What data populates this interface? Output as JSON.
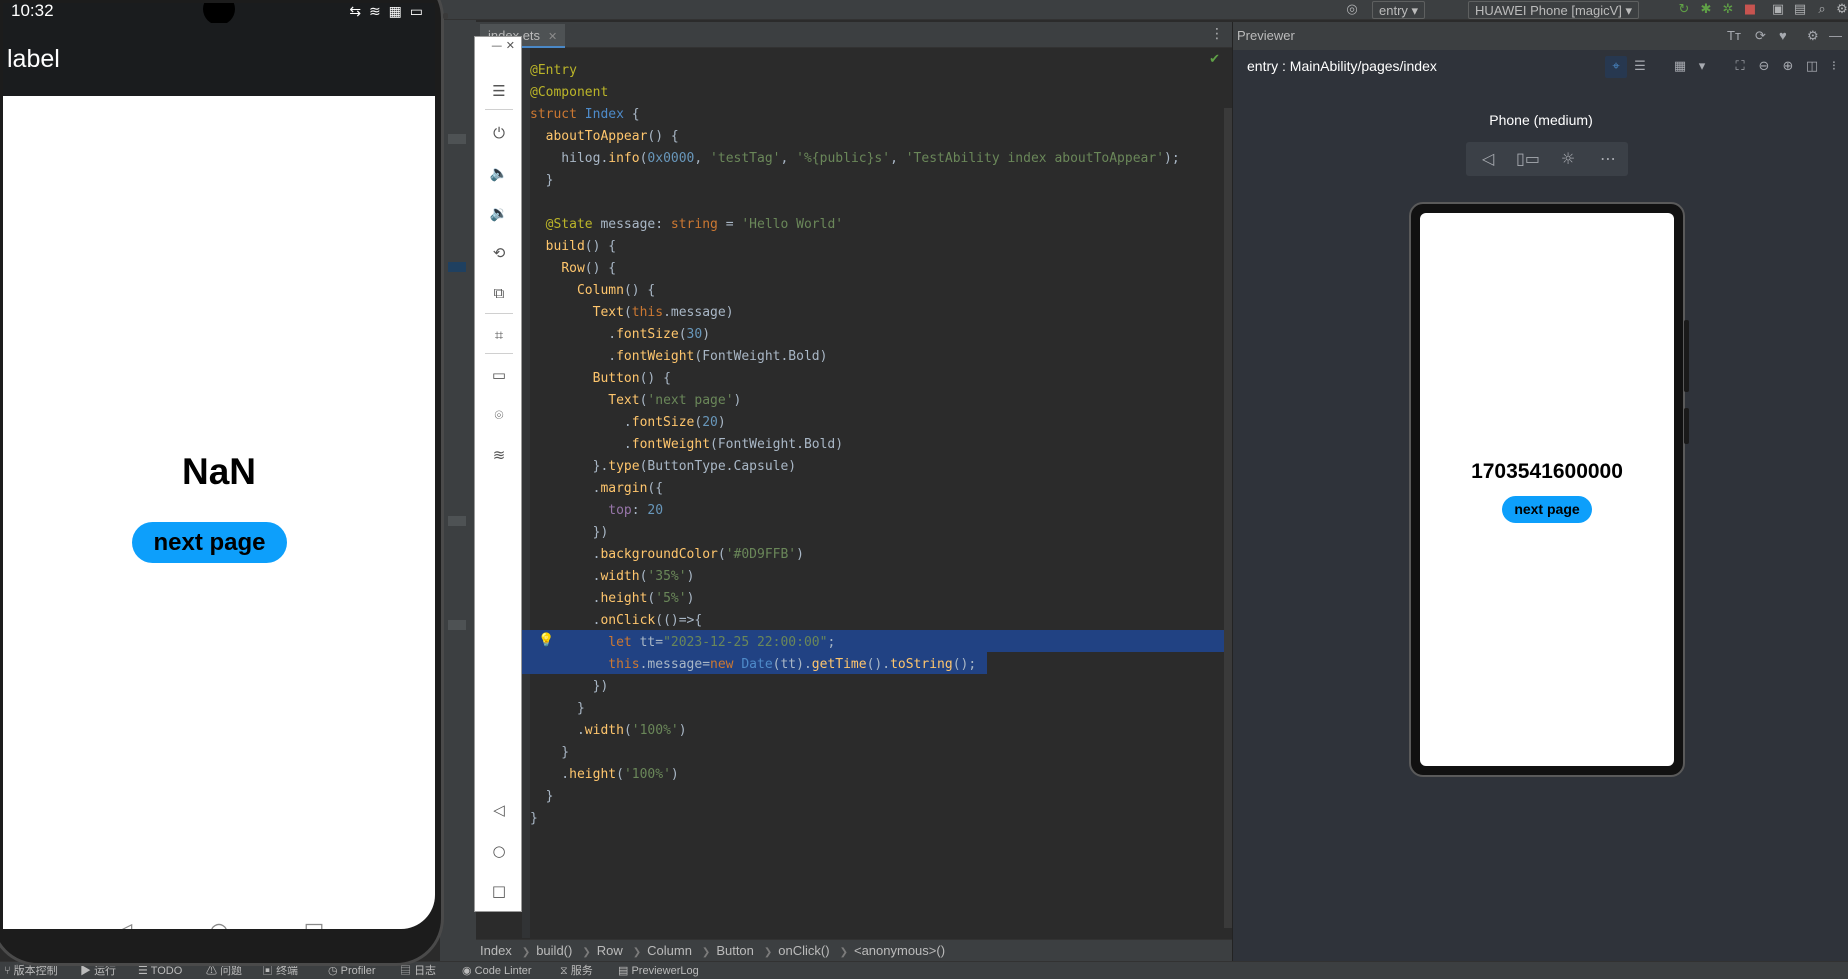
{
  "toolbar": {
    "run_config": "entry",
    "device": "HUAWEI Phone [magicV]"
  },
  "editor": {
    "tab_name": "index.ets",
    "lines": [
      [
        [
          "an",
          "@Entry"
        ]
      ],
      [
        [
          "an",
          "@Component"
        ]
      ],
      [
        [
          "kw",
          "struct "
        ],
        [
          "ty",
          "Index"
        ],
        [
          "df",
          " {"
        ]
      ],
      [
        [
          "df",
          "  "
        ],
        [
          "fn",
          "aboutToAppear"
        ],
        [
          "df",
          "() {"
        ]
      ],
      [
        [
          "df",
          "    hilog."
        ],
        [
          "fn",
          "info"
        ],
        [
          "df",
          "("
        ],
        [
          "nm",
          "0x0000"
        ],
        [
          "df",
          ", "
        ],
        [
          "st",
          "'testTag'"
        ],
        [
          "df",
          ", "
        ],
        [
          "st",
          "'%{public}s'"
        ],
        [
          "df",
          ", "
        ],
        [
          "st",
          "'TestAbility index aboutToAppear'"
        ],
        [
          "df",
          ");"
        ]
      ],
      [
        [
          "df",
          "  }"
        ]
      ],
      [
        [
          "df",
          ""
        ]
      ],
      [
        [
          "an",
          "  @State "
        ],
        [
          "df",
          "message: "
        ],
        [
          "kw",
          "string"
        ],
        [
          "df",
          " = "
        ],
        [
          "st",
          "'Hello World'"
        ]
      ],
      [
        [
          "df",
          "  "
        ],
        [
          "fn",
          "build"
        ],
        [
          "df",
          "() {"
        ]
      ],
      [
        [
          "df",
          "    "
        ],
        [
          "fn",
          "Row"
        ],
        [
          "df",
          "() {"
        ]
      ],
      [
        [
          "df",
          "      "
        ],
        [
          "fn",
          "Column"
        ],
        [
          "df",
          "() {"
        ]
      ],
      [
        [
          "df",
          "        "
        ],
        [
          "fn",
          "Text"
        ],
        [
          "df",
          "("
        ],
        [
          "kw",
          "this"
        ],
        [
          "df",
          ".message)"
        ]
      ],
      [
        [
          "df",
          "          ."
        ],
        [
          "fn",
          "fontSize"
        ],
        [
          "df",
          "("
        ],
        [
          "nm",
          "30"
        ],
        [
          "df",
          ")"
        ]
      ],
      [
        [
          "df",
          "          ."
        ],
        [
          "fn",
          "fontWeight"
        ],
        [
          "df",
          "(FontWeight.Bold)"
        ]
      ],
      [
        [
          "df",
          "        "
        ],
        [
          "fn",
          "Button"
        ],
        [
          "df",
          "() {"
        ]
      ],
      [
        [
          "df",
          "          "
        ],
        [
          "fn",
          "Text"
        ],
        [
          "df",
          "("
        ],
        [
          "st",
          "'next page'"
        ],
        [
          "df",
          ")"
        ]
      ],
      [
        [
          "df",
          "            ."
        ],
        [
          "fn",
          "fontSize"
        ],
        [
          "df",
          "("
        ],
        [
          "nm",
          "20"
        ],
        [
          "df",
          ")"
        ]
      ],
      [
        [
          "df",
          "            ."
        ],
        [
          "fn",
          "fontWeight"
        ],
        [
          "df",
          "(FontWeight.Bold)"
        ]
      ],
      [
        [
          "df",
          "        }."
        ],
        [
          "fn",
          "type"
        ],
        [
          "df",
          "(ButtonType.Capsule)"
        ]
      ],
      [
        [
          "df",
          "        ."
        ],
        [
          "fn",
          "margin"
        ],
        [
          "df",
          "({"
        ]
      ],
      [
        [
          "df",
          "          "
        ],
        [
          "pr",
          "top"
        ],
        [
          "df",
          ": "
        ],
        [
          "nm",
          "20"
        ]
      ],
      [
        [
          "df",
          "        })"
        ]
      ],
      [
        [
          "df",
          "        ."
        ],
        [
          "fn",
          "backgroundColor"
        ],
        [
          "df",
          "("
        ],
        [
          "st",
          "'#0D9FFB'"
        ],
        [
          "df",
          ")"
        ]
      ],
      [
        [
          "df",
          "        ."
        ],
        [
          "fn",
          "width"
        ],
        [
          "df",
          "("
        ],
        [
          "st",
          "'35%'"
        ],
        [
          "df",
          ")"
        ]
      ],
      [
        [
          "df",
          "        ."
        ],
        [
          "fn",
          "height"
        ],
        [
          "df",
          "("
        ],
        [
          "st",
          "'5%'"
        ],
        [
          "df",
          ")"
        ]
      ],
      [
        [
          "df",
          "        ."
        ],
        [
          "fn",
          "onClick"
        ],
        [
          "df",
          "(()=>{"
        ]
      ],
      [
        [
          "kw",
          "          let "
        ],
        [
          "df",
          "tt="
        ],
        [
          "st",
          "\"2023-12-25 22:00:00\""
        ],
        [
          "df",
          ";"
        ]
      ],
      [
        [
          "kw",
          "          this"
        ],
        [
          "df",
          ".message="
        ],
        [
          "kw",
          "new "
        ],
        [
          "ty",
          "Date"
        ],
        [
          "df",
          "(tt)."
        ],
        [
          "fn",
          "getTime"
        ],
        [
          "df",
          "()."
        ],
        [
          "fn",
          "toString"
        ],
        [
          "df",
          "();"
        ]
      ],
      [
        [
          "df",
          "        })"
        ]
      ],
      [
        [
          "df",
          "      }"
        ]
      ],
      [
        [
          "df",
          "      ."
        ],
        [
          "fn",
          "width"
        ],
        [
          "df",
          "("
        ],
        [
          "st",
          "'100%'"
        ],
        [
          "df",
          ")"
        ]
      ],
      [
        [
          "df",
          "    }"
        ]
      ],
      [
        [
          "df",
          "    ."
        ],
        [
          "fn",
          "height"
        ],
        [
          "df",
          "("
        ],
        [
          "st",
          "'100%'"
        ],
        [
          "df",
          ")"
        ]
      ],
      [
        [
          "df",
          "  }"
        ]
      ],
      [
        [
          "df",
          "}"
        ]
      ]
    ]
  },
  "breadcrumb": [
    "Index",
    "build()",
    "Row",
    "Column",
    "Button",
    "onClick()",
    "<anonymous>()"
  ],
  "statusbar": [
    "版本控制",
    "运行",
    "TODO",
    "问题",
    "终端",
    "Profiler",
    "日志",
    "Code Linter",
    "服务",
    "PreviewerLog"
  ],
  "previewer": {
    "header": "Previewer",
    "path": "entry : MainAbility/pages/index",
    "device_label": "Phone (medium)",
    "screen_text": "1703541600000",
    "button_label": "next page"
  },
  "phone": {
    "time": "10:32",
    "title": "label",
    "text": "NaN",
    "button_label": "next page"
  },
  "colors": {
    "button": "#0D9FFB",
    "highlight": "#214283"
  }
}
